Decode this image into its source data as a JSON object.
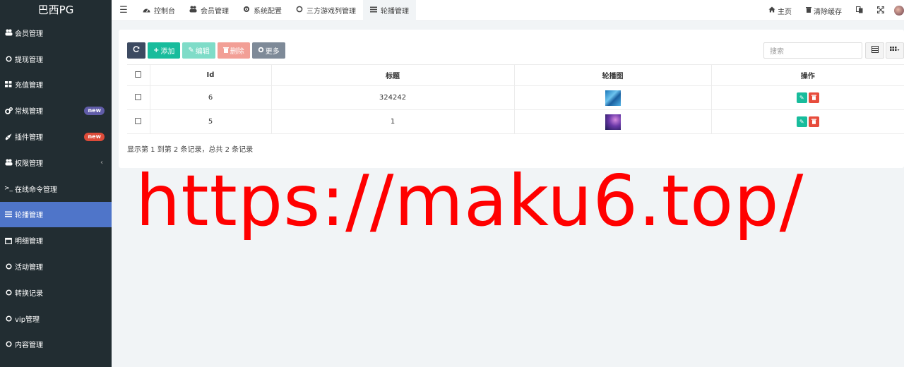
{
  "sidebar": {
    "logo": "巴西PG",
    "items": [
      {
        "label": "会员管理",
        "icon": "users-icon"
      },
      {
        "label": "提现管理",
        "icon": "circle-icon"
      },
      {
        "label": "充值管理",
        "icon": "grid-icon"
      },
      {
        "label": "常规管理",
        "icon": "cogs-icon",
        "badge": "new"
      },
      {
        "label": "插件管理",
        "icon": "rocket-icon",
        "badge": "new"
      },
      {
        "label": "权限管理",
        "icon": "users-icon"
      },
      {
        "label": "在线命令管理",
        "icon": "terminal-icon"
      },
      {
        "label": "轮播管理",
        "icon": "list-icon"
      },
      {
        "label": "明细管理",
        "icon": "calendar-icon"
      },
      {
        "label": "活动管理",
        "icon": "circle-icon"
      },
      {
        "label": "转换记录",
        "icon": "circle-icon"
      },
      {
        "label": "vip管理",
        "icon": "circle-icon"
      },
      {
        "label": "内容管理",
        "icon": "circle-icon"
      }
    ]
  },
  "topbar": {
    "tabs": [
      {
        "label": "控制台",
        "icon": "dashboard-icon"
      },
      {
        "label": "会员管理",
        "icon": "users-icon"
      },
      {
        "label": "系统配置",
        "icon": "cog-icon"
      },
      {
        "label": "三方游戏列管理",
        "icon": "circle-icon"
      },
      {
        "label": "轮播管理",
        "icon": "list-icon"
      }
    ],
    "home": "主页",
    "clear_cache": "清除缓存"
  },
  "toolbar": {
    "add": "添加",
    "edit": "编辑",
    "delete": "删除",
    "more": "更多",
    "search_placeholder": "搜索"
  },
  "table": {
    "headers": {
      "id": "Id",
      "title": "标题",
      "image": "轮播图",
      "ops": "操作"
    },
    "rows": [
      {
        "id": "6",
        "title": "324242"
      },
      {
        "id": "5",
        "title": "1"
      }
    ]
  },
  "footer": {
    "info": "显示第 1 到第 2 条记录，总共 2 条记录"
  },
  "watermark": "https://maku6.top/"
}
